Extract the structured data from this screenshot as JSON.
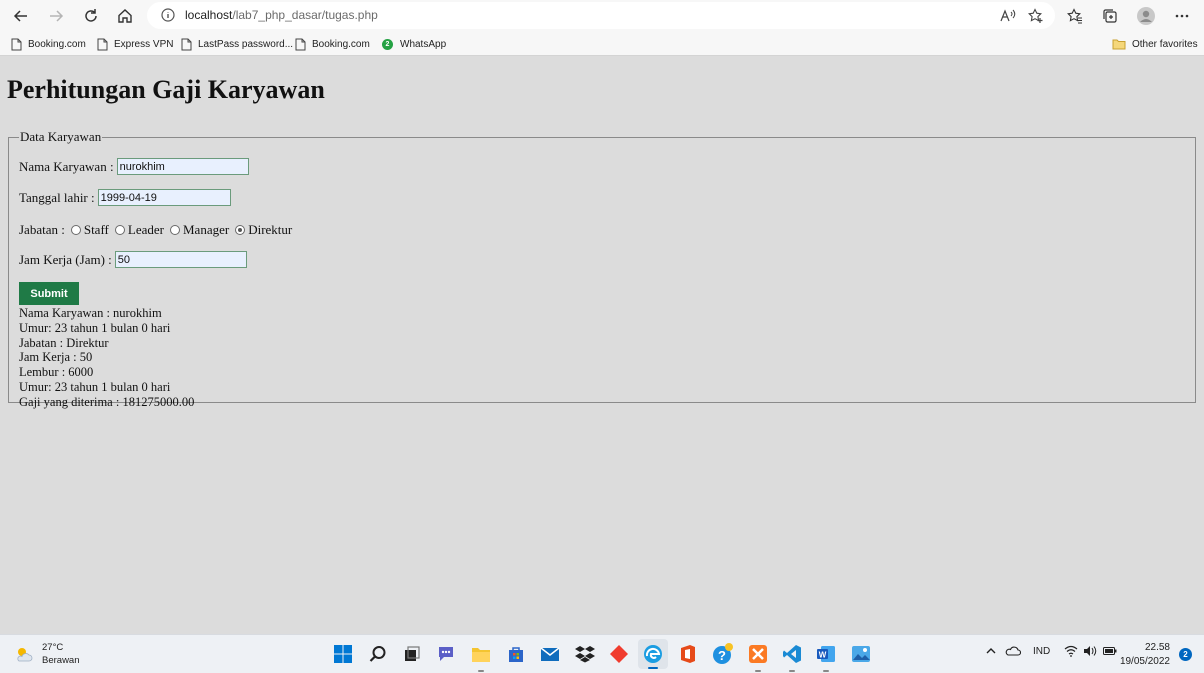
{
  "browser": {
    "url_host": "localhost",
    "url_path": "/lab7_php_dasar/tugas.php",
    "bookmarks": [
      {
        "label": "Booking.com"
      },
      {
        "label": "Express VPN"
      },
      {
        "label": "LastPass password..."
      },
      {
        "label": "Booking.com"
      },
      {
        "label": "WhatsApp"
      }
    ],
    "other_favorites": "Other favorites"
  },
  "page": {
    "title": "Perhitungan Gaji Karyawan",
    "fieldset_legend": "Data Karyawan",
    "form": {
      "name_label": "Nama Karyawan :",
      "name_value": "nurokhim",
      "dob_label": "Tanggal lahir :",
      "dob_value": "1999-04-19",
      "jabatan_label": "Jabatan :",
      "jabatan_options": [
        "Staff",
        "Leader",
        "Manager",
        "Direktur"
      ],
      "jabatan_selected": "Direktur",
      "hours_label": "Jam Kerja (Jam) :",
      "hours_value": "50",
      "submit_label": "Submit"
    },
    "results": [
      "Nama Karyawan : nurokhim",
      "Umur: 23 tahun 1 bulan 0 hari",
      "Jabatan : Direktur",
      "Jam Kerja : 50",
      "Lembur : 6000",
      "Umur: 23 tahun 1 bulan 0 hari",
      "Gaji yang diterima : 181275000.00"
    ]
  },
  "taskbar": {
    "weather_temp": "27°C",
    "weather_desc": "Berawan",
    "language": "IND",
    "time": "22.58",
    "date": "19/05/2022",
    "notification_count": "2"
  }
}
